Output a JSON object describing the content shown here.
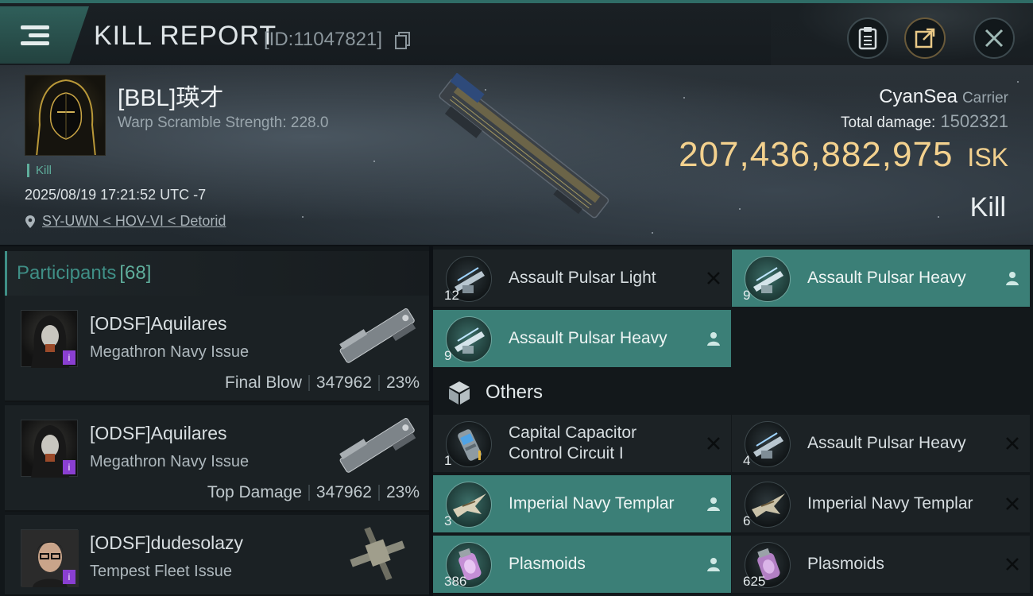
{
  "header": {
    "title": "KILL REPORT",
    "report_id": "[ID:11047821]"
  },
  "victim": {
    "name": "[BBL]瑛才",
    "warp_scramble": "Warp Scramble Strength: 228.0",
    "kill_tag": "Kill",
    "timestamp": "2025/08/19 17:21:52 UTC -7",
    "location": "SY-UWN < HOV-VI < Detorid"
  },
  "summary": {
    "killer_name": "CyanSea",
    "killer_class": "Carrier",
    "total_damage_label": "Total damage:",
    "total_damage_value": "1502321",
    "isk_value": "207,436,882,975",
    "isk_unit": "ISK",
    "result": "Kill"
  },
  "participants": {
    "label": "Participants",
    "count": "[68]",
    "list": [
      {
        "name": "[ODSF]Aquilares",
        "ship": "Megathron Navy Issue",
        "role": "Final Blow",
        "damage": "347962",
        "percent": "23%"
      },
      {
        "name": "[ODSF]Aquilares",
        "ship": "Megathron Navy Issue",
        "role": "Top Damage",
        "damage": "347962",
        "percent": "23%"
      },
      {
        "name": "[ODSF]dudesolazy",
        "ship": "Tempest Fleet Issue",
        "role": "",
        "damage": "",
        "percent": ""
      }
    ]
  },
  "items": {
    "top": [
      {
        "name": "Assault Pulsar Light",
        "qty": "12",
        "status": "destroyed"
      },
      {
        "name": "Assault Pulsar Heavy",
        "qty": "9",
        "status": "dropped"
      },
      {
        "name": "Assault Pulsar Heavy",
        "qty": "9",
        "status": "dropped"
      }
    ],
    "others_label": "Others",
    "others": [
      {
        "name": "Capital Capacitor Control Circuit I",
        "qty": "1",
        "status": "destroyed"
      },
      {
        "name": "Assault Pulsar Heavy",
        "qty": "4",
        "status": "destroyed"
      },
      {
        "name": "Imperial Navy Templar",
        "qty": "3",
        "status": "dropped"
      },
      {
        "name": "Imperial Navy Templar",
        "qty": "6",
        "status": "destroyed"
      },
      {
        "name": "Plasmoids",
        "qty": "386",
        "status": "dropped"
      },
      {
        "name": "Plasmoids",
        "qty": "625",
        "status": "destroyed"
      }
    ]
  },
  "colors": {
    "accent_teal": "#3f8f86",
    "drop_teal": "#3b7f77",
    "isk_gold": "#f3d18e",
    "corp_badge": "#8a3fd1"
  }
}
